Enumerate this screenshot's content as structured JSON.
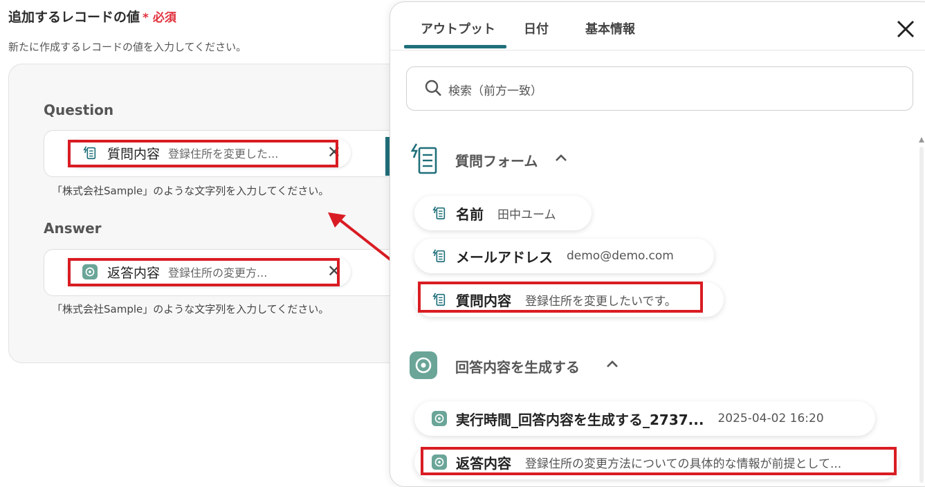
{
  "section": {
    "title": "追加するレコードの値",
    "required_mark": "*",
    "required_label": "必須",
    "description": "新たに作成するレコードの値を入力してください。"
  },
  "fields": [
    {
      "label": "Question",
      "chip": {
        "key": "質問内容",
        "value": "登録住所を変更した...",
        "icon": "form-icon"
      },
      "hint": "「株式会社Sample」のような文字列を入力してください。"
    },
    {
      "label": "Answer",
      "chip": {
        "key": "返答内容",
        "value": "登録住所の変更方...",
        "icon": "ai-icon"
      },
      "hint": "「株式会社Sample」のような文字列を入力してください。"
    }
  ],
  "panel": {
    "tabs": [
      {
        "label": "アウトプット",
        "active": true
      },
      {
        "label": "日付",
        "active": false
      },
      {
        "label": "基本情報",
        "active": false
      }
    ],
    "search_placeholder": "検索（前方一致）",
    "groups": [
      {
        "title": "質問フォーム",
        "icon": "form-icon",
        "items": [
          {
            "key": "名前",
            "value": "田中ユーム"
          },
          {
            "key": "メールアドレス",
            "value": "demo@demo.com"
          },
          {
            "key": "質問内容",
            "value": "登録住所を変更したいです。"
          }
        ]
      },
      {
        "title": "回答内容を生成する",
        "icon": "ai-icon",
        "items": [
          {
            "key": "実行時間_回答内容を生成する_2737...",
            "value": "2025-04-02 16:20"
          },
          {
            "key": "返答内容",
            "value": "登録住所の変更方法についての具体的な情報が前提として..."
          }
        ]
      }
    ]
  },
  "colors": {
    "accent": "#1f6f7a",
    "required": "#e0303c",
    "highlight": "#d91c23",
    "ai_icon": "#6aa598"
  }
}
